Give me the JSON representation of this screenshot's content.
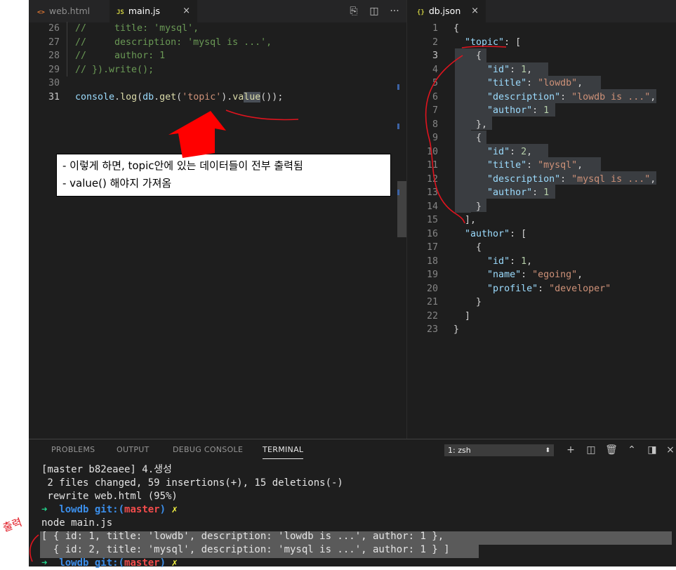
{
  "tabs_left": [
    {
      "icon": "<>",
      "label": "web.html",
      "active": false
    },
    {
      "icon": "JS",
      "label": "main.js",
      "active": true
    }
  ],
  "tab_right": {
    "icon": "{}",
    "label": "db.json",
    "close": "×"
  },
  "main_js": {
    "lines": [
      {
        "num": "26",
        "parts": [
          [
            "c-comment",
            "//     title: 'mysql',"
          ]
        ]
      },
      {
        "num": "27",
        "parts": [
          [
            "c-comment",
            "//     description: 'mysql is ...',"
          ]
        ]
      },
      {
        "num": "28",
        "parts": [
          [
            "c-comment",
            "//     author: 1"
          ]
        ]
      },
      {
        "num": "29",
        "parts": [
          [
            "c-comment",
            "// }).write();"
          ]
        ]
      },
      {
        "num": "30",
        "parts": []
      },
      {
        "num": "31",
        "parts": [
          [
            "c-var",
            "console"
          ],
          [
            "c-plain",
            "."
          ],
          [
            "c-fn",
            "log"
          ],
          [
            "c-plain",
            "("
          ],
          [
            "c-var",
            "db"
          ],
          [
            "c-plain",
            "."
          ],
          [
            "c-fn",
            "get"
          ],
          [
            "c-plain",
            "("
          ],
          [
            "c-str",
            "'topic'"
          ],
          [
            "c-plain",
            ")."
          ],
          [
            "c-fn",
            "va"
          ],
          [
            "c-fn sel-bg",
            "lue"
          ],
          [
            "c-plain",
            "());"
          ]
        ]
      }
    ]
  },
  "db_json": {
    "lines": [
      {
        "num": "1",
        "parts": [
          [
            "c-plain",
            "{"
          ]
        ]
      },
      {
        "num": "2",
        "parts": [
          [
            "c-plain",
            "  "
          ],
          [
            "c-key",
            "\"topic\""
          ],
          [
            "c-plain",
            ": ["
          ]
        ]
      },
      {
        "num": "3",
        "parts": [
          [
            "c-plain",
            "    {"
          ]
        ]
      },
      {
        "num": "4",
        "parts": [
          [
            "c-plain",
            "      "
          ],
          [
            "c-key",
            "\"id\""
          ],
          [
            "c-plain",
            ": "
          ],
          [
            "c-num",
            "1"
          ],
          [
            "c-plain",
            ","
          ]
        ]
      },
      {
        "num": "5",
        "parts": [
          [
            "c-plain",
            "      "
          ],
          [
            "c-key",
            "\"title\""
          ],
          [
            "c-plain",
            ": "
          ],
          [
            "c-str",
            "\"lowdb\""
          ],
          [
            "c-plain",
            ","
          ]
        ]
      },
      {
        "num": "6",
        "parts": [
          [
            "c-plain",
            "      "
          ],
          [
            "c-key",
            "\"description\""
          ],
          [
            "c-plain",
            ": "
          ],
          [
            "c-str",
            "\"lowdb is ...\""
          ],
          [
            "c-plain",
            ","
          ]
        ]
      },
      {
        "num": "7",
        "parts": [
          [
            "c-plain",
            "      "
          ],
          [
            "c-key",
            "\"author\""
          ],
          [
            "c-plain",
            ": "
          ],
          [
            "c-num",
            "1"
          ]
        ]
      },
      {
        "num": "8",
        "parts": [
          [
            "c-plain",
            "    },"
          ]
        ]
      },
      {
        "num": "9",
        "parts": [
          [
            "c-plain",
            "    {"
          ]
        ]
      },
      {
        "num": "10",
        "parts": [
          [
            "c-plain",
            "      "
          ],
          [
            "c-key",
            "\"id\""
          ],
          [
            "c-plain",
            ": "
          ],
          [
            "c-num",
            "2"
          ],
          [
            "c-plain",
            ","
          ]
        ]
      },
      {
        "num": "11",
        "parts": [
          [
            "c-plain",
            "      "
          ],
          [
            "c-key",
            "\"title\""
          ],
          [
            "c-plain",
            ": "
          ],
          [
            "c-str",
            "\"mysql\""
          ],
          [
            "c-plain",
            ","
          ]
        ]
      },
      {
        "num": "12",
        "parts": [
          [
            "c-plain",
            "      "
          ],
          [
            "c-key",
            "\"description\""
          ],
          [
            "c-plain",
            ": "
          ],
          [
            "c-str",
            "\"mysql is ...\""
          ],
          [
            "c-plain",
            ","
          ]
        ]
      },
      {
        "num": "13",
        "parts": [
          [
            "c-plain",
            "      "
          ],
          [
            "c-key",
            "\"author\""
          ],
          [
            "c-plain",
            ": "
          ],
          [
            "c-num",
            "1"
          ]
        ]
      },
      {
        "num": "14",
        "parts": [
          [
            "c-plain",
            "    }"
          ]
        ]
      },
      {
        "num": "15",
        "parts": [
          [
            "c-plain",
            "  ],"
          ]
        ]
      },
      {
        "num": "16",
        "parts": [
          [
            "c-plain",
            "  "
          ],
          [
            "c-key",
            "\"author\""
          ],
          [
            "c-plain",
            ": ["
          ]
        ]
      },
      {
        "num": "17",
        "parts": [
          [
            "c-plain",
            "    {"
          ]
        ]
      },
      {
        "num": "18",
        "parts": [
          [
            "c-plain",
            "      "
          ],
          [
            "c-key",
            "\"id\""
          ],
          [
            "c-plain",
            ": "
          ],
          [
            "c-num",
            "1"
          ],
          [
            "c-plain",
            ","
          ]
        ]
      },
      {
        "num": "19",
        "parts": [
          [
            "c-plain",
            "      "
          ],
          [
            "c-key",
            "\"name\""
          ],
          [
            "c-plain",
            ": "
          ],
          [
            "c-str",
            "\"egoing\""
          ],
          [
            "c-plain",
            ","
          ]
        ]
      },
      {
        "num": "20",
        "parts": [
          [
            "c-plain",
            "      "
          ],
          [
            "c-key",
            "\"profile\""
          ],
          [
            "c-plain",
            ": "
          ],
          [
            "c-str",
            "\"developer\""
          ]
        ]
      },
      {
        "num": "21",
        "parts": [
          [
            "c-plain",
            "    }"
          ]
        ]
      },
      {
        "num": "22",
        "parts": [
          [
            "c-plain",
            "  ]"
          ]
        ]
      },
      {
        "num": "23",
        "parts": [
          [
            "c-plain",
            "}"
          ]
        ]
      }
    ]
  },
  "callout": {
    "line1": "- 이렇게 하면, topic안에 있는 데이터들이 전부 출력됨",
    "line2": "- value() 해야지 가져옴"
  },
  "panel": {
    "tabs": [
      "PROBLEMS",
      "OUTPUT",
      "DEBUG CONSOLE",
      "TERMINAL"
    ],
    "active_tab": "TERMINAL",
    "shell_select": "1: zsh",
    "terminal_lines": [
      [
        [
          "",
          "[master b82eaee] 4.생성"
        ]
      ],
      [
        [
          "",
          " 2 files changed, 59 insertions(+), 15 deletions(-)"
        ]
      ],
      [
        [
          "",
          " rewrite web.html (95%)"
        ]
      ],
      [
        [
          "t-green",
          "➜  "
        ],
        [
          "t-blue",
          "lowdb "
        ],
        [
          "t-blue",
          "git:("
        ],
        [
          "t-red",
          "master"
        ],
        [
          "t-blue",
          ") "
        ],
        [
          "t-yellow",
          "✗"
        ]
      ],
      [
        [
          "",
          "node main.js"
        ]
      ],
      [
        [
          "",
          "[ { id: 1, title: 'lowdb', description: 'lowdb is ...', author: 1 },"
        ]
      ],
      [
        [
          "",
          "  { id: 2, title: 'mysql', description: 'mysql is ...', author: 1 } ]"
        ]
      ],
      [
        [
          "t-green",
          "➜  "
        ],
        [
          "t-blue",
          "lowdb "
        ],
        [
          "t-blue",
          "git:("
        ],
        [
          "t-red",
          "master"
        ],
        [
          "t-blue",
          ") "
        ],
        [
          "t-yellow",
          "✗"
        ]
      ]
    ]
  },
  "handwriting": "출력",
  "colors": {
    "annotation_red": "#e0141e",
    "arrow_red": "#ff0000"
  }
}
